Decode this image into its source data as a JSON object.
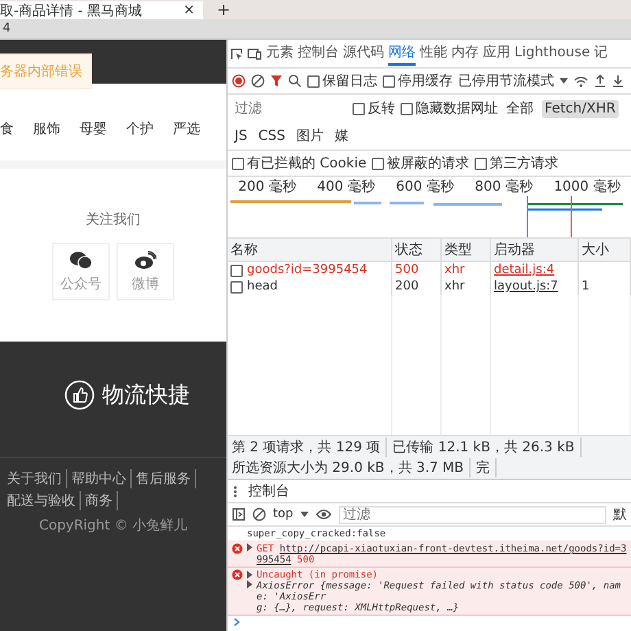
{
  "browser": {
    "tab_title": "取-商品详情 - 黑马商城",
    "tab_close": "×",
    "new_tab": "+",
    "address": "4"
  },
  "site": {
    "toast": "务器内部错误",
    "nav": [
      "食",
      "服饰",
      "母婴",
      "个护",
      "严选"
    ],
    "follow_title": "关注我们",
    "follow_items": [
      {
        "kind": "wechat",
        "label": "公众号"
      },
      {
        "kind": "weibo",
        "label": "微博"
      }
    ],
    "slogan": "物流快捷",
    "footer_links": [
      "关于我们",
      "帮助中心",
      "售后服务",
      "配送与验收",
      "商务"
    ],
    "copyright": "CopyRight © 小兔鲜儿"
  },
  "devtools": {
    "tabs": [
      {
        "label": "元素",
        "selected": false
      },
      {
        "label": "控制台",
        "selected": false
      },
      {
        "label": "源代码",
        "selected": false
      },
      {
        "label": "网络",
        "selected": true
      },
      {
        "label": "性能",
        "selected": false
      },
      {
        "label": "内存",
        "selected": false
      },
      {
        "label": "应用",
        "selected": false
      },
      {
        "label": "Lighthouse",
        "selected": false
      },
      {
        "label": "记",
        "selected": false
      }
    ],
    "toolbar_checks": [
      {
        "label": "保留日志",
        "checked": false
      },
      {
        "label": "停用缓存",
        "checked": false
      }
    ],
    "throttle": "已停用节流模式",
    "filter_placeholder": "过滤",
    "filter_checks": [
      {
        "label": "反转",
        "checked": false
      },
      {
        "label": "隐藏数据网址",
        "checked": false
      }
    ],
    "type_filters": [
      {
        "label": "全部",
        "selected": false
      },
      {
        "label": "Fetch/XHR",
        "selected": true
      },
      {
        "label": "JS",
        "selected": false
      },
      {
        "label": "CSS",
        "selected": false
      },
      {
        "label": "图片",
        "selected": false
      },
      {
        "label": "媒",
        "selected": false
      }
    ],
    "request_checks": [
      {
        "label": "有已拦截的 Cookie",
        "checked": false
      },
      {
        "label": "被屏蔽的请求",
        "checked": false
      },
      {
        "label": "第三方请求",
        "checked": false
      }
    ],
    "timeline_ticks": [
      "200 毫秒",
      "400 毫秒",
      "600 毫秒",
      "800 毫秒",
      "1000 毫秒"
    ],
    "columns": [
      "名称",
      "状态",
      "类型",
      "启动器",
      "大小"
    ],
    "rows": [
      {
        "cells": [
          "goods?id=3995454",
          "500",
          "xhr",
          "detail.js:4"
        ],
        "failed": true,
        "checked": false
      },
      {
        "cells": [
          "head",
          "200",
          "xhr",
          "layout.js:7",
          "1"
        ],
        "failed": false,
        "checked": false
      }
    ],
    "summary": [
      "第 2 项请求，共 129 项",
      "已传输 12.1 kB，共 26.3 kB",
      "所选资源大小为 29.0 kB，共 3.7 MB",
      "完"
    ]
  },
  "console": {
    "tab": "控制台",
    "context": "top",
    "filter_placeholder": "过滤",
    "levels": "默",
    "messages": [
      {
        "kind": "log",
        "text": "super_copy_cracked:false"
      },
      {
        "kind": "request-error",
        "method": "GET",
        "url": "http://pcapi-xiaotuxian-front-devtest.itheima.net/goods?id=3995454",
        "status": "500"
      },
      {
        "kind": "error",
        "text": "Uncaught (in promise)",
        "detail_lines": [
          "AxiosError {message: 'Request failed with status code 500', name: 'AxiosErr",
          "g: {…}, request: XMLHttpRequest, …}"
        ]
      }
    ]
  }
}
